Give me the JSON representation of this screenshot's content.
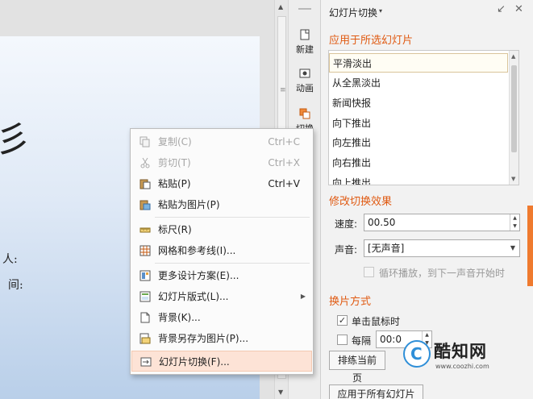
{
  "slide": {
    "big_char": "彡",
    "line1_char": "人:",
    "line2_char": "间:"
  },
  "rail": {
    "items": [
      {
        "label": "新建",
        "icon": "new-slide-icon"
      },
      {
        "label": "动画",
        "icon": "animation-icon"
      },
      {
        "label": "切换",
        "icon": "transition-icon"
      }
    ]
  },
  "pane": {
    "title": "幻灯片切换",
    "title_caret": "▾",
    "controls": {
      "restore": "↙",
      "close": "✕"
    },
    "apply_section": "应用于所选幻灯片",
    "transitions": [
      "平滑淡出",
      "从全黑淡出",
      "新闻快报",
      "向下推出",
      "向左推出",
      "向右推出",
      "向上推出"
    ],
    "selected_transition_index": 0,
    "modify_section": "修改切换效果",
    "speed_label": "速度:",
    "speed_value": "00.50",
    "sound_label": "声音:",
    "sound_value": "[无声音]",
    "loop_label": "循环播放，到下一声音开始时",
    "loop_checked": false,
    "advance_section": "换片方式",
    "on_click_label": "单击鼠标时",
    "on_click_checked": true,
    "every_label": "每隔",
    "every_checked": false,
    "every_value": "00:0",
    "rehearse_button": "排练当前页",
    "apply_all_button": "应用于所有幻灯片"
  },
  "watermark": {
    "logo_letter": "C",
    "brand": "酷知网",
    "url": "www.coozhi.com"
  },
  "context_menu": {
    "items": [
      {
        "label": "复制(C)",
        "shortcut": "Ctrl+C",
        "disabled": true,
        "icon": "copy-icon"
      },
      {
        "label": "剪切(T)",
        "shortcut": "Ctrl+X",
        "disabled": true,
        "icon": "cut-icon"
      },
      {
        "label": "粘贴(P)",
        "shortcut": "Ctrl+V",
        "disabled": false,
        "icon": "paste-icon"
      },
      {
        "label": "粘贴为图片(P)",
        "shortcut": "",
        "disabled": false,
        "icon": "paste-as-picture-icon"
      },
      {
        "label": "标尺(R)",
        "shortcut": "",
        "disabled": false,
        "icon": "ruler-icon"
      },
      {
        "label": "网格和参考线(I)...",
        "shortcut": "",
        "disabled": false,
        "icon": "grid-icon"
      },
      {
        "label": "更多设计方案(E)...",
        "shortcut": "",
        "disabled": false,
        "icon": "design-icon"
      },
      {
        "label": "幻灯片版式(L)...",
        "shortcut": "",
        "disabled": false,
        "icon": "layout-icon",
        "submenu": true
      },
      {
        "label": "背景(K)...",
        "shortcut": "",
        "disabled": false,
        "icon": "background-icon"
      },
      {
        "label": "背景另存为图片(P)...",
        "shortcut": "",
        "disabled": false,
        "icon": "save-background-icon"
      },
      {
        "label": "幻灯片切换(F)...",
        "shortcut": "",
        "disabled": false,
        "icon": "slide-transition-icon",
        "highlighted": true
      }
    ]
  }
}
